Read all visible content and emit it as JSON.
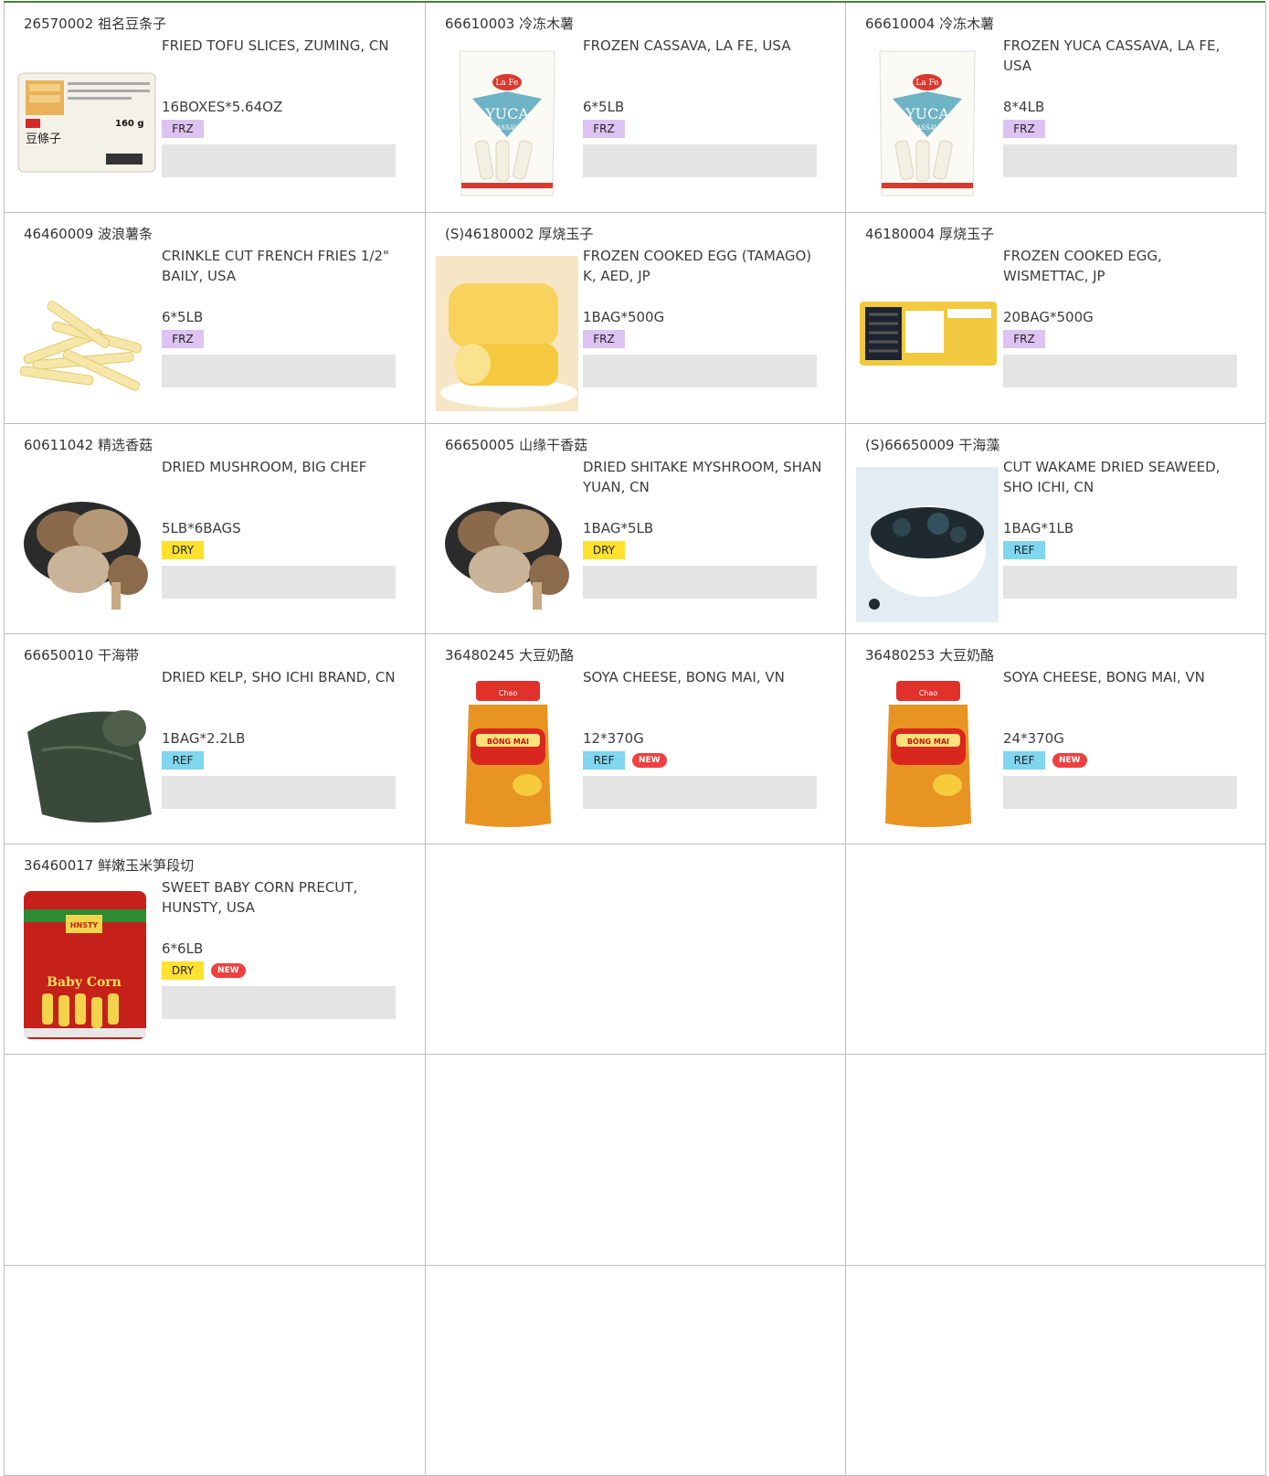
{
  "products": [
    {
      "code": "26570002 祖名豆条子",
      "desc": "FRIED TOFU SLICES, ZUMING, CN",
      "pack": "16BOXES*5.64OZ",
      "storage": "FRZ",
      "is_new": false,
      "image": "tofu-package-image"
    },
    {
      "code": "66610003 冷冻木薯",
      "desc": "FROZEN CASSAVA, LA FE, USA",
      "pack": "6*5LB",
      "storage": "FRZ",
      "is_new": false,
      "image": "cassava-bag-image"
    },
    {
      "code": "66610004 冷冻木薯",
      "desc": "FROZEN YUCA CASSAVA, LA FE, USA",
      "pack": "8*4LB",
      "storage": "FRZ",
      "is_new": false,
      "image": "yuca-bag-image"
    },
    {
      "code": "46460009 波浪薯条",
      "desc": "CRINKLE CUT FRENCH FRIES 1/2\" BAILY, USA",
      "pack": "6*5LB",
      "storage": "FRZ",
      "is_new": false,
      "image": "fries-image"
    },
    {
      "code": "(S)46180002 厚烧玉子",
      "desc": "FROZEN COOKED EGG (TAMAGO) K, AED, JP",
      "pack": "1BAG*500G",
      "storage": "FRZ",
      "is_new": false,
      "image": "tamago-image"
    },
    {
      "code": "46180004 厚烧玉子",
      "desc": "FROZEN COOKED EGG, WISMETTAC, JP",
      "pack": "20BAG*500G",
      "storage": "FRZ",
      "is_new": false,
      "image": "egg-package-image"
    },
    {
      "code": "60611042 精选香菇",
      "desc": "DRIED MUSHROOM, BIG CHEF",
      "pack": "5LB*6BAGS",
      "storage": "DRY",
      "is_new": false,
      "image": "mushroom-image"
    },
    {
      "code": "66650005 山缘干香菇",
      "desc": "DRIED SHITAKE MYSHROOM, SHAN YUAN, CN",
      "pack": "1BAG*5LB",
      "storage": "DRY",
      "is_new": false,
      "image": "mushroom-image"
    },
    {
      "code": "(S)66650009 干海藻",
      "desc": "CUT WAKAME DRIED SEAWEED, SHO ICHI, CN",
      "pack": "1BAG*1LB",
      "storage": "REF",
      "is_new": false,
      "image": "seaweed-bowl-image"
    },
    {
      "code": "66650010 干海带",
      "desc": "DRIED KELP, SHO ICHI BRAND, CN",
      "pack": "1BAG*2.2LB",
      "storage": "REF",
      "is_new": false,
      "image": "kelp-image"
    },
    {
      "code": "36480245 大豆奶酪",
      "desc": "SOYA CHEESE, BONG MAI, VN",
      "pack": "12*370G",
      "storage": "REF",
      "is_new": true,
      "image": "cheese-jar-image"
    },
    {
      "code": "36480253 大豆奶酪",
      "desc": "SOYA CHEESE, BONG MAI, VN",
      "pack": "24*370G",
      "storage": "REF",
      "is_new": true,
      "image": "cheese-jar-image"
    },
    {
      "code": "36460017 鲜嫩玉米笋段切",
      "desc": "SWEET BABY CORN PRECUT, HUNSTY, USA",
      "pack": "6*6LB",
      "storage": "DRY",
      "is_new": true,
      "image": "baby-corn-can-image"
    }
  ],
  "new_badge_label": "NEW",
  "jar_label": "BÔNG MAI",
  "can_label": "Baby Corn",
  "can_brand": "HNSTY",
  "cassava_brand": "La Fe",
  "cassava_label": "YUCA",
  "cassava_sub": "CASSAVA",
  "tofu_weight": "160 g",
  "tofu_name": "豆條子",
  "empty_cells": 8,
  "colors": {
    "FRZ": "#dcc3f1",
    "DRY": "#ffe12e",
    "REF": "#7fd6ee",
    "new": "#ef4040",
    "border": "#bcbcbc",
    "input": "#e4e4e4"
  }
}
